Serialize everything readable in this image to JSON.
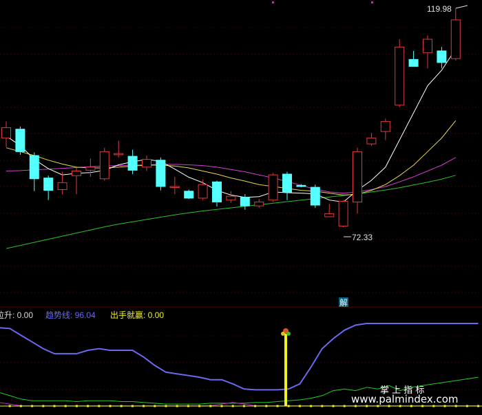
{
  "colors": {
    "background": "#000000",
    "grid": "#3a0000",
    "up": "#e03a3a",
    "down": "#54ffff",
    "ma5": "#ffffff",
    "ma10": "#e8d84a",
    "ma20": "#d43fd4",
    "ma60": "#29c429",
    "trend": "#6a6af0",
    "signal": "#f0f020",
    "green_line": "#20d020",
    "magenta_line": "#d020d0",
    "magenta_marker": "#d020d0",
    "label_text": "#d8d8d8"
  },
  "chart_data": {
    "type": "candlestick",
    "x": [
      1,
      2,
      3,
      4,
      5,
      6,
      7,
      8,
      9,
      10,
      11,
      12,
      13,
      14,
      15,
      16,
      17,
      18,
      19,
      20,
      21,
      22,
      23,
      24,
      25,
      26,
      27,
      28,
      29,
      30,
      31,
      32,
      33,
      34
    ],
    "ohlc": [
      [
        86.5,
        90.8,
        84.2,
        89.2
      ],
      [
        88.8,
        89.5,
        82.2,
        83.0
      ],
      [
        82.0,
        82.8,
        72.8,
        76.0
      ],
      [
        76.2,
        76.8,
        70.5,
        73.0
      ],
      [
        73.2,
        77.8,
        72.0,
        75.0
      ],
      [
        76.8,
        78.8,
        72.0,
        78.0
      ],
      [
        78.2,
        81.2,
        76.5,
        79.0
      ],
      [
        76.0,
        84.0,
        75.5,
        83.0
      ],
      [
        82.2,
        85.8,
        81.5,
        82.5
      ],
      [
        81.8,
        83.5,
        77.2,
        78.2
      ],
      [
        79.0,
        82.0,
        78.0,
        81.0
      ],
      [
        80.8,
        81.5,
        73.0,
        74.0
      ],
      [
        74.0,
        76.5,
        72.0,
        74.0
      ],
      [
        72.8,
        73.2,
        70.8,
        71.0
      ],
      [
        71.0,
        75.8,
        70.5,
        74.5
      ],
      [
        75.2,
        75.5,
        68.8,
        70.0
      ],
      [
        70.5,
        72.8,
        69.8,
        71.5
      ],
      [
        71.2,
        72.0,
        68.0,
        69.0
      ],
      [
        69.0,
        70.8,
        68.5,
        70.0
      ],
      [
        70.5,
        77.5,
        70.0,
        77.0
      ],
      [
        77.2,
        77.8,
        70.5,
        72.5
      ],
      [
        74.3,
        74.6,
        73.8,
        74.0
      ],
      [
        73.8,
        74.5,
        68.5,
        69.2
      ],
      [
        66.2,
        69.5,
        72.33,
        67.0
      ],
      [
        63.8,
        70.5,
        63.5,
        70.2
      ],
      [
        70.0,
        84.0,
        67.0,
        83.0
      ],
      [
        85.0,
        87.8,
        84.5,
        86.5
      ],
      [
        88.2,
        91.5,
        86.0,
        90.8
      ],
      [
        95.0,
        112.0,
        94.5,
        110.0
      ],
      [
        106.8,
        109.0,
        106.5,
        105.0
      ],
      [
        108.5,
        113.0,
        104.5,
        112.0
      ],
      [
        109.0,
        110.0,
        104.5,
        106.0
      ],
      [
        107.0,
        119.98,
        106.5,
        117.0
      ]
    ],
    "ma5": [
      87.0,
      84.6,
      81.0,
      78.6,
      77.0,
      77.4,
      77.6,
      78.2,
      79.6,
      80.4,
      81.0,
      80.5,
      78.5,
      76.4,
      75.0,
      73.0,
      71.8,
      71.2,
      71.4,
      72.6,
      72.4,
      72.3,
      72.1,
      70.5,
      70.0,
      73.0,
      75.6,
      79.0,
      86.0,
      93.0,
      100.0,
      104.0,
      109.5
    ],
    "ma10": [
      84.0,
      83.0,
      82.0,
      80.8,
      79.8,
      79.0,
      78.8,
      78.8,
      79.0,
      79.3,
      79.5,
      79.5,
      79.3,
      78.8,
      78.0,
      77.2,
      76.2,
      75.4,
      74.5,
      74.0,
      73.5,
      73.0,
      72.8,
      72.3,
      71.8,
      72.0,
      73.0,
      74.5,
      76.8,
      79.5,
      83.0,
      86.5,
      91.0
    ],
    "ma20": [
      78.0,
      78.1,
      78.3,
      78.5,
      78.7,
      78.9,
      79.1,
      79.3,
      79.4,
      79.5,
      79.6,
      79.7,
      79.7,
      79.6,
      79.4,
      79.0,
      78.4,
      77.8,
      77.0,
      76.2,
      75.3,
      74.3,
      73.3,
      72.6,
      72.3,
      72.6,
      73.2,
      74.0,
      75.2,
      76.5,
      78.0,
      79.5,
      81.5
    ],
    "ma60": [
      58.0,
      58.8,
      59.6,
      60.4,
      61.2,
      62.0,
      62.8,
      63.6,
      64.3,
      64.9,
      65.5,
      66.1,
      66.7,
      67.2,
      67.7,
      68.1,
      68.5,
      68.9,
      69.3,
      69.7,
      70.1,
      70.5,
      70.9,
      71.3,
      71.7,
      72.1,
      72.6,
      73.1,
      73.7,
      74.4,
      75.1,
      75.9,
      76.9
    ],
    "annotations": {
      "high_label": "119.98",
      "low_label": "72.33",
      "jie_label": "解"
    },
    "indicator": {
      "legend": [
        {
          "text": "拉升: 0.00",
          "color": "#d8d8d8"
        },
        {
          "text": "趋势线: 96.04",
          "color": "#6a6af0"
        },
        {
          "text": "出手就赢: 0.00",
          "color": "#f0f020"
        }
      ],
      "trend": [
        95,
        94,
        86,
        78,
        70,
        64,
        64,
        64,
        68,
        70,
        68,
        68,
        68,
        60,
        50,
        42,
        40,
        38,
        36,
        33,
        33,
        28,
        22,
        21,
        21,
        21,
        22,
        28,
        48,
        70,
        82,
        92,
        98,
        100,
        100,
        100,
        100,
        100,
        100,
        100,
        100,
        100,
        100,
        100
      ],
      "green": [
        18,
        14,
        10,
        8,
        8,
        8,
        8,
        7,
        8,
        8,
        8,
        7,
        7,
        6,
        5,
        4,
        4,
        4,
        4,
        5,
        5,
        5,
        5,
        6,
        6,
        7,
        8,
        9,
        11,
        14,
        20,
        22,
        20,
        24,
        22,
        26,
        20,
        24,
        26,
        28,
        30,
        32,
        34,
        36
      ],
      "magenta": [
        6,
        4,
        2,
        2,
        2,
        2,
        2,
        2,
        2,
        2,
        2,
        2,
        2,
        2,
        2,
        2,
        2,
        2,
        2,
        2,
        4,
        6,
        4,
        2,
        2,
        2,
        2,
        2,
        2,
        2,
        2,
        2,
        2,
        2,
        2,
        2,
        2,
        2,
        2,
        2,
        2,
        2,
        2,
        2
      ],
      "signal_index": 20,
      "signal_value": 78
    }
  },
  "watermark": {
    "line1": "掌 上 指 标",
    "line2": "www.palmindex.com"
  }
}
